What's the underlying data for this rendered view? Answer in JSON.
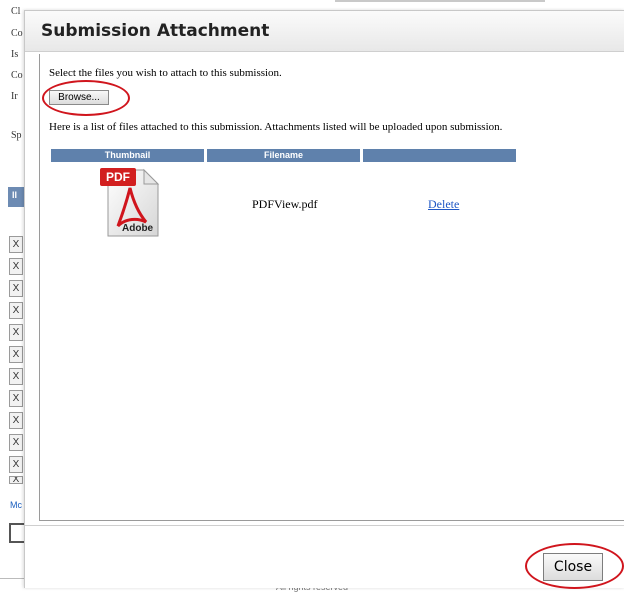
{
  "background": {
    "left_labels": [
      "Cl",
      "Co",
      "Is",
      "Co",
      "Ir",
      "Sp"
    ],
    "column_header": "II",
    "x_buttons": [
      "X",
      "X",
      "X",
      "X",
      "X",
      "X",
      "X",
      "X",
      "X",
      "X",
      "X",
      "X"
    ],
    "link_text": "Mc",
    "footer": "All rights reserved"
  },
  "modal": {
    "title": "Submission Attachment",
    "instruction": "Select the files you wish to attach to this submission.",
    "browse_label": "Browse...",
    "list_info": "Here is a list of files attached to this submission. Attachments listed will be uploaded upon submission.",
    "table": {
      "columns": [
        "Thumbnail",
        "Filename",
        ""
      ],
      "rows": [
        {
          "thumbnail_icon": "pdf-file-icon",
          "thumb_label_top": "PDF",
          "thumb_label_bottom": "Adobe",
          "filename": "PDFView.pdf",
          "action": "Delete"
        }
      ]
    },
    "close_label": "Close"
  },
  "colors": {
    "table_header": "#5f81ac",
    "annotation": "#d0151d",
    "link": "#1f57c5"
  }
}
